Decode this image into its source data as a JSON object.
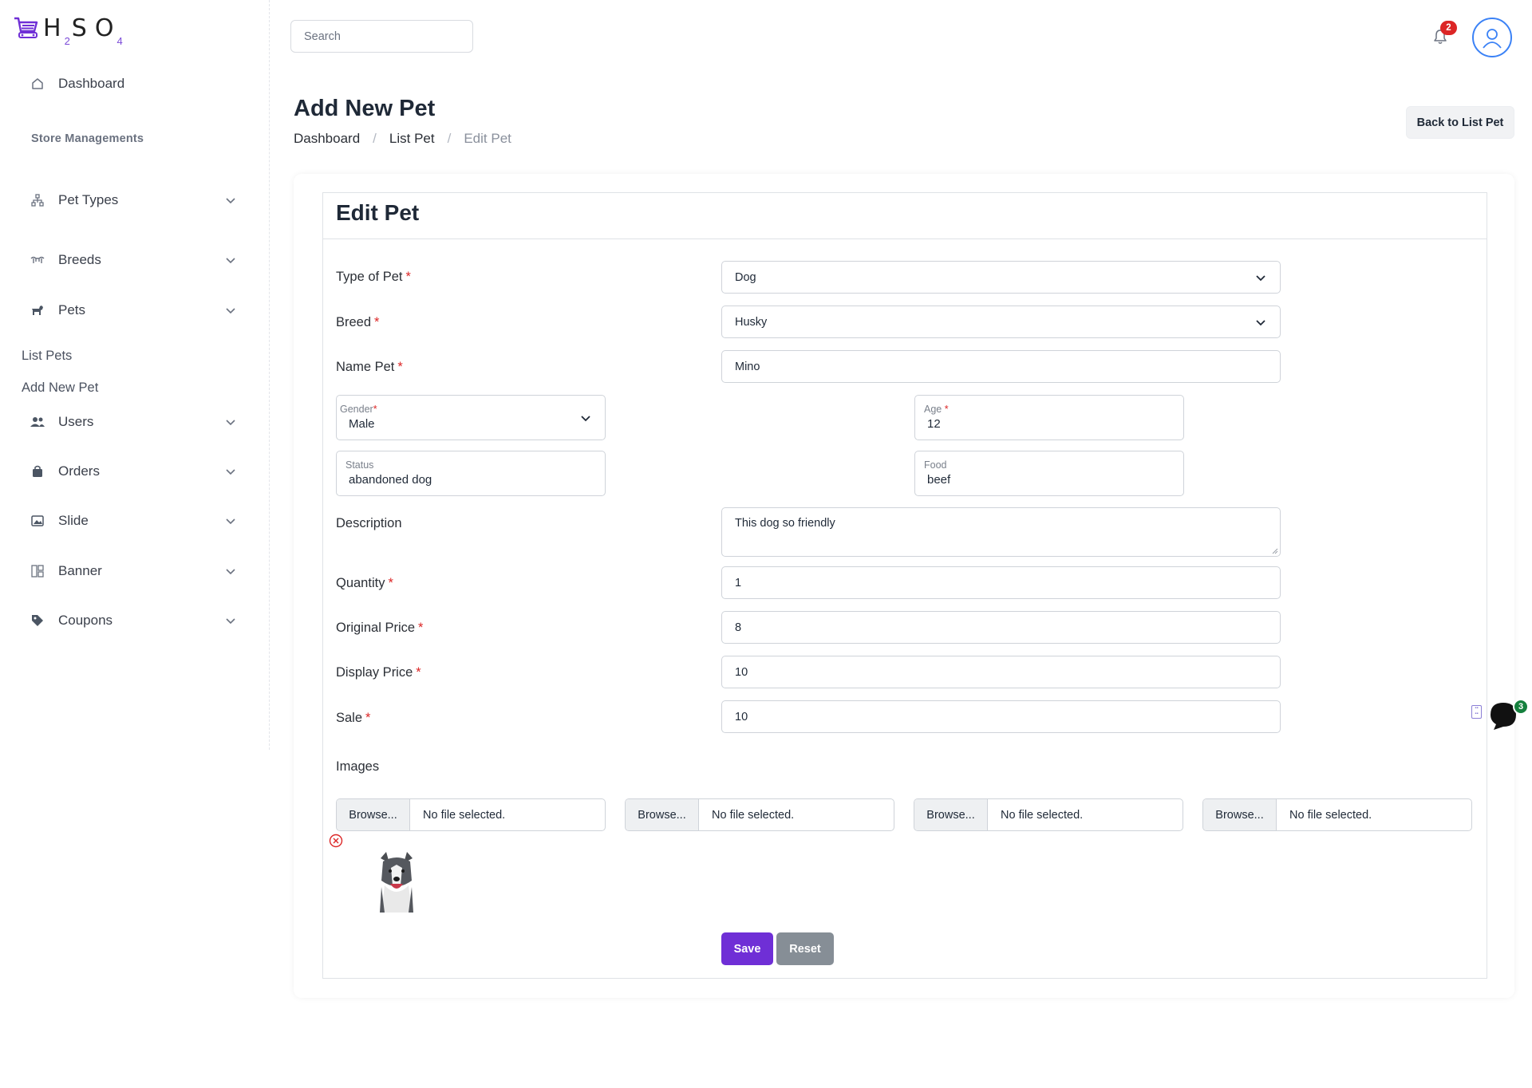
{
  "brand": {
    "logo_h": "H",
    "logo_2": "2",
    "logo_s": "S",
    "logo_o": "O",
    "logo_4": "4",
    "accent": "#6f2fd6"
  },
  "sidebar": {
    "dashboard": "Dashboard",
    "section": "Store Managements",
    "items": [
      {
        "label": "Pet Types",
        "icon": "sitemap-icon"
      },
      {
        "label": "Breeds",
        "icon": "breeds-icon"
      },
      {
        "label": "Pets",
        "icon": "dog-icon"
      },
      {
        "label": "Users",
        "icon": "users-icon"
      },
      {
        "label": "Orders",
        "icon": "bag-icon"
      },
      {
        "label": "Slide",
        "icon": "image-icon"
      },
      {
        "label": "Banner",
        "icon": "layout-icon"
      },
      {
        "label": "Coupons",
        "icon": "tag-icon"
      }
    ],
    "pets_sub": [
      "List Pets",
      "Add New Pet"
    ]
  },
  "header": {
    "search_placeholder": "Search",
    "notifications": "2"
  },
  "page": {
    "title": "Add New Pet",
    "breadcrumb": [
      "Dashboard",
      "List Pet",
      "Edit Pet"
    ],
    "back_button": "Back to List Pet"
  },
  "form": {
    "title": "Edit Pet",
    "required_mark": "*",
    "type_label": "Type of Pet",
    "type_value": "Dog",
    "breed_label": "Breed",
    "breed_value": "Husky",
    "name_label": "Name Pet",
    "name_value": "Mino",
    "gender_label": "Gender",
    "gender_value": "Male",
    "age_label": "Age",
    "age_value": "12",
    "status_label": "Status",
    "status_value": "abandoned dog",
    "food_label": "Food",
    "food_value": "beef",
    "description_label": "Description",
    "description_value": "This dog so friendly",
    "quantity_label": "Quantity",
    "quantity_value": "1",
    "original_price_label": "Original Price",
    "original_price_value": "8",
    "display_price_label": "Display Price",
    "display_price_value": "10",
    "sale_label": "Sale",
    "sale_value": "10",
    "images_label": "Images",
    "browse_label": "Browse...",
    "no_file": "No file selected.",
    "save": "Save",
    "reset": "Reset"
  },
  "chat": {
    "badge": "3"
  }
}
